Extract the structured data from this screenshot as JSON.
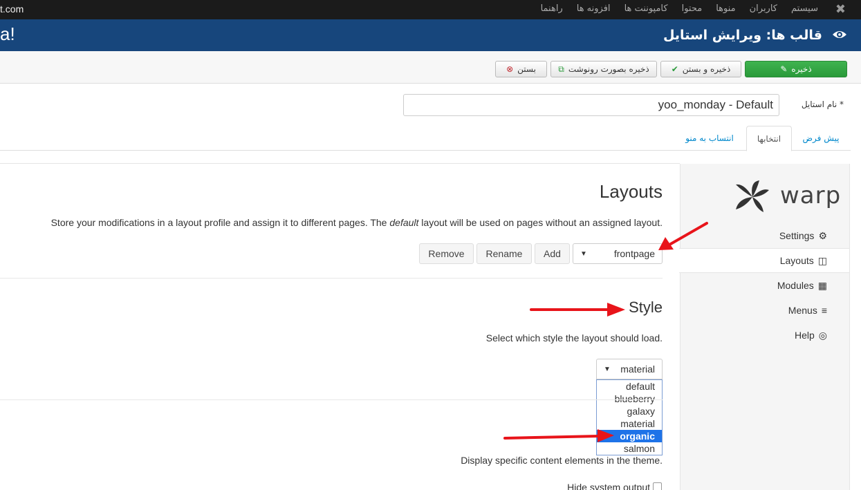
{
  "topnav": {
    "site_url": "t.com",
    "items": [
      "سیستم",
      "کاربران",
      "منوها",
      "محتوا",
      "کامپوننت ها",
      "افزونه ها",
      "راهنما"
    ]
  },
  "header": {
    "logo_fragment": "a!",
    "title": "قالب ها: ویرایش استایل"
  },
  "toolbar": {
    "save_label": "ذخیره",
    "save_close_label": "ذخیره و بستن",
    "save_copy_label": "ذخیره بصورت رونوشت",
    "close_label": "بستن"
  },
  "form": {
    "style_name_label": "نام استایل *",
    "style_name_value": "yoo_monday - Default"
  },
  "tabs": {
    "default": "پیش فرض",
    "options": "انتخابها",
    "menu_assignment": "انتساب به منو"
  },
  "warp": {
    "logo_text": "warp",
    "sidebar": [
      "Settings",
      "Layouts",
      "Modules",
      "Menus",
      "Help"
    ]
  },
  "layouts": {
    "heading": "Layouts",
    "desc_part1": "Store your modifications in a layout profile and assign it to different pages. The ",
    "desc_italic": "default",
    "desc_part2": " layout will be used on pages without an assigned layout.",
    "selected": "frontpage",
    "add_label": "Add",
    "rename_label": "Rename",
    "remove_label": "Remove"
  },
  "style": {
    "heading": "Style",
    "desc": "Select which style the layout should load.",
    "selected": "material",
    "options": [
      "default",
      "blueberry",
      "galaxy",
      "material",
      "organic",
      "salmon"
    ],
    "highlighted": "organic"
  },
  "system_output": {
    "desc": "Display specific content elements in the theme.",
    "hide_label": "Hide system output"
  },
  "colors": {
    "header_blue": "#17467c",
    "save_green": "#2a9a3a",
    "highlight_blue": "#1e73e8",
    "annotation_red": "#e8141a"
  }
}
